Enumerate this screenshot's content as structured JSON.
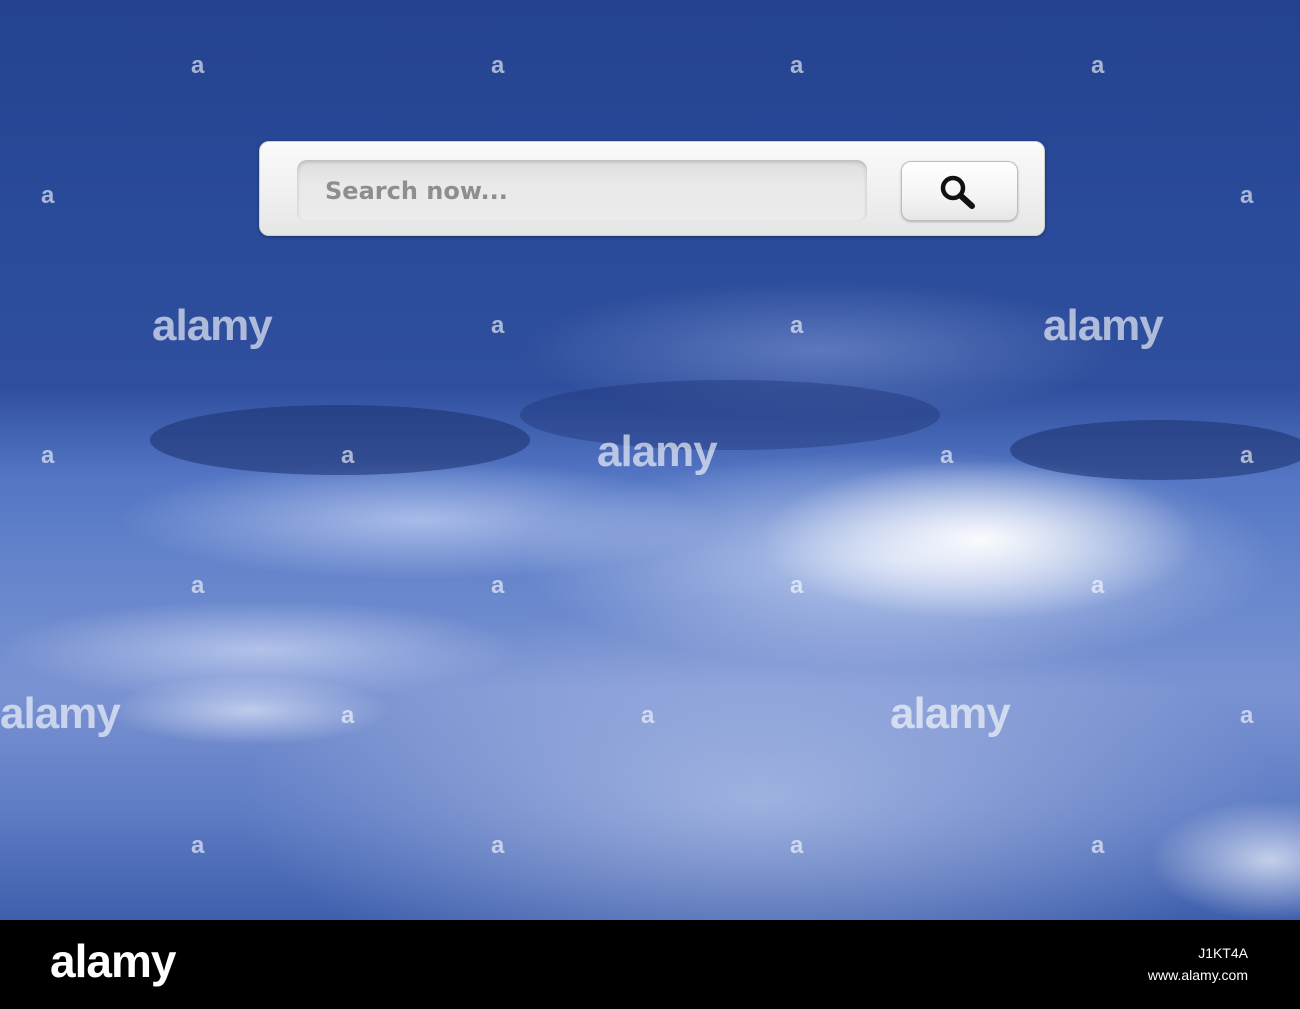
{
  "search": {
    "placeholder": "Search now...",
    "button_icon": "search-icon"
  },
  "watermark": {
    "logo_text": "alamy",
    "small_mark": "a"
  },
  "footer": {
    "logo_text": "alamy",
    "image_id": "J1KT4A",
    "url": "www.alamy.com"
  },
  "colors": {
    "sky_top": "#24428f",
    "sky_mid": "#5476c4",
    "footer_bg": "#000000",
    "search_bar_bg": "#f0f0f0",
    "placeholder_text": "#8e8e8e"
  }
}
